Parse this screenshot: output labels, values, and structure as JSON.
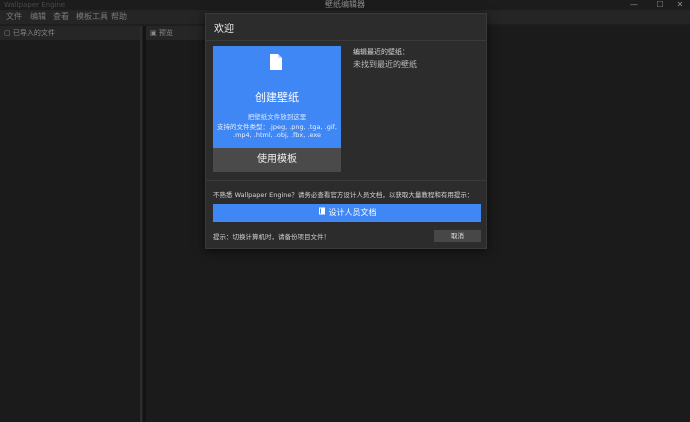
{
  "window": {
    "logo_text": "Wallpaper Engine",
    "title": "壁纸编辑器",
    "controls": [
      "—",
      "☐",
      "✕"
    ]
  },
  "menubar": [
    "文件",
    "编辑",
    "查看",
    "模板工具",
    "帮助"
  ],
  "panels": {
    "imported_files": "已导入的文件",
    "preview": "预览"
  },
  "dialog": {
    "title": "欢迎",
    "create": {
      "label": "创建壁纸",
      "hint_drag": "把壁纸文件放到这里",
      "hint_types_1": "支持的文件类型：.jpeg, .png, .tga, .gif,",
      "hint_types_2": ".mp4, .html, .obj, .fbx, .exe"
    },
    "template_button": "使用模板",
    "recent": {
      "label": "编辑最近的壁纸：",
      "empty": "未找到最近的壁纸"
    },
    "unfamiliar_text": "不熟悉 Wallpaper Engine？请务必查看官方设计人员文档，以获取大量教程和有用提示：",
    "docs_button": "设计人员文档",
    "tip": "提示：切换计算机时，请备份项目文件！",
    "cancel_button": "取消"
  },
  "colors": {
    "accent": "#3f87f5",
    "background": "#1e1e1e",
    "dialog": "#2c2c2c"
  }
}
